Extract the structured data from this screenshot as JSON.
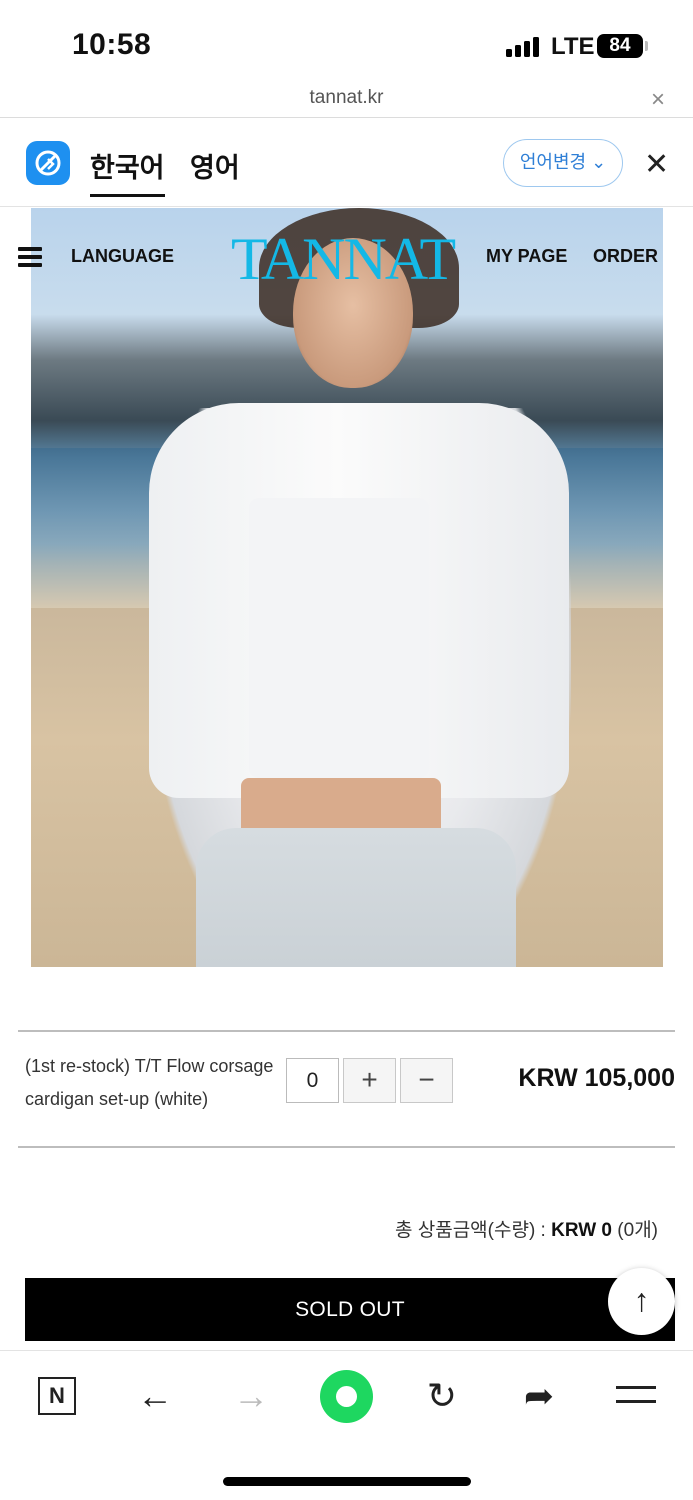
{
  "status_bar": {
    "time": "10:58",
    "network": "LTE",
    "battery": "84"
  },
  "url_bar": {
    "url": "tannat.kr",
    "close_glyph": "×"
  },
  "translation_bar": {
    "tabs": [
      {
        "label": "한국어",
        "active": true
      },
      {
        "label": "영어",
        "active": false
      }
    ],
    "change_language_label": "언어변경 ⌄",
    "close_glyph": "✕"
  },
  "site_header": {
    "language_link": "LANGUAGE",
    "brand": "TANNAT",
    "mypage_link": "MY PAGE",
    "order_link": "ORDER",
    "brand_color": "#14b8e6"
  },
  "product": {
    "name": "(1st re-stock) T/T Flow corsage cardigan set-up (white)",
    "quantity": "0",
    "plus_glyph": "+",
    "minus_glyph": "−",
    "price": "KRW 105,000"
  },
  "total": {
    "label": "총 상품금액(수량) : ",
    "amount": "KRW 0",
    "count": " (0개)"
  },
  "soldout_label": "SOLD OUT",
  "scroll_top_glyph": "↑",
  "toolbar": {
    "n_label": "N",
    "back_glyph": "←",
    "forward_glyph": "→",
    "reload_glyph": "↻",
    "share_glyph": "➦"
  },
  "icons": [
    "hamburger-menu-icon",
    "translate-logo-icon",
    "close-icon",
    "arrow-up-icon",
    "naver-n-icon",
    "back-arrow-icon",
    "forward-arrow-icon",
    "green-home-icon",
    "reload-icon",
    "share-icon",
    "menu-icon"
  ]
}
